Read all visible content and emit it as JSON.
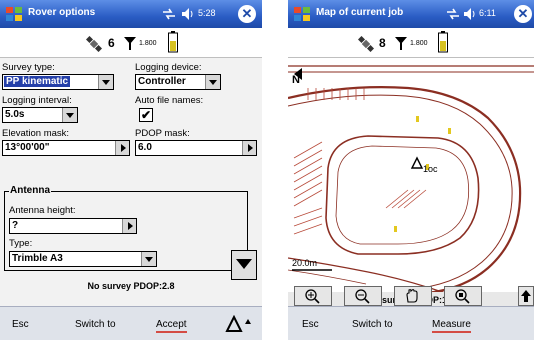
{
  "left": {
    "title": "Rover options",
    "time": "5:28",
    "sat_count": "6",
    "antenna_value": "1.800",
    "survey_type_label": "Survey type:",
    "survey_type_value": "PP kinematic",
    "logging_device_label": "Logging device:",
    "logging_device_value": "Controller",
    "logging_interval_label": "Logging interval:",
    "logging_interval_value": "5.0s",
    "auto_file_names_label": "Auto file names:",
    "auto_file_names_checked": "✔",
    "elevation_mask_label": "Elevation mask:",
    "elevation_mask_value": "13°00'00\"",
    "pdop_mask_label": "PDOP mask:",
    "pdop_mask_value": "6.0",
    "antenna_group_title": "Antenna",
    "antenna_height_label": "Antenna height:",
    "antenna_height_value": "?",
    "type_label": "Type:",
    "type_value": "Trimble A3",
    "status": "No survey  PDOP:2.8",
    "soft_esc": "Esc",
    "soft_switch": "Switch to",
    "soft_accept": "Accept"
  },
  "right": {
    "title": "Map of current job",
    "time": "6:11",
    "sat_count": "8",
    "antenna_value": "1.800",
    "north_label": "N",
    "point_label": "1oc",
    "scale_label": "20.0m",
    "status": "No survey  PDOP:1.6",
    "soft_esc": "Esc",
    "soft_switch": "Switch to",
    "soft_measure": "Measure"
  },
  "colors": {
    "title_bar": "#2a5cc4",
    "selection": "#243fa8",
    "map_road": "#8b2e22",
    "map_parking": "#b84a3a",
    "softkey_underline": "#d44c44"
  },
  "icons": [
    "windows-flag-icon",
    "signal-icon",
    "speaker-icon",
    "close-icon",
    "satellite-icon",
    "antenna-icon",
    "battery-icon",
    "zoom-in-icon",
    "zoom-out-icon",
    "pan-hand-icon",
    "zoom-extents-icon",
    "keyboard-icon",
    "up-arrow-icon"
  ]
}
